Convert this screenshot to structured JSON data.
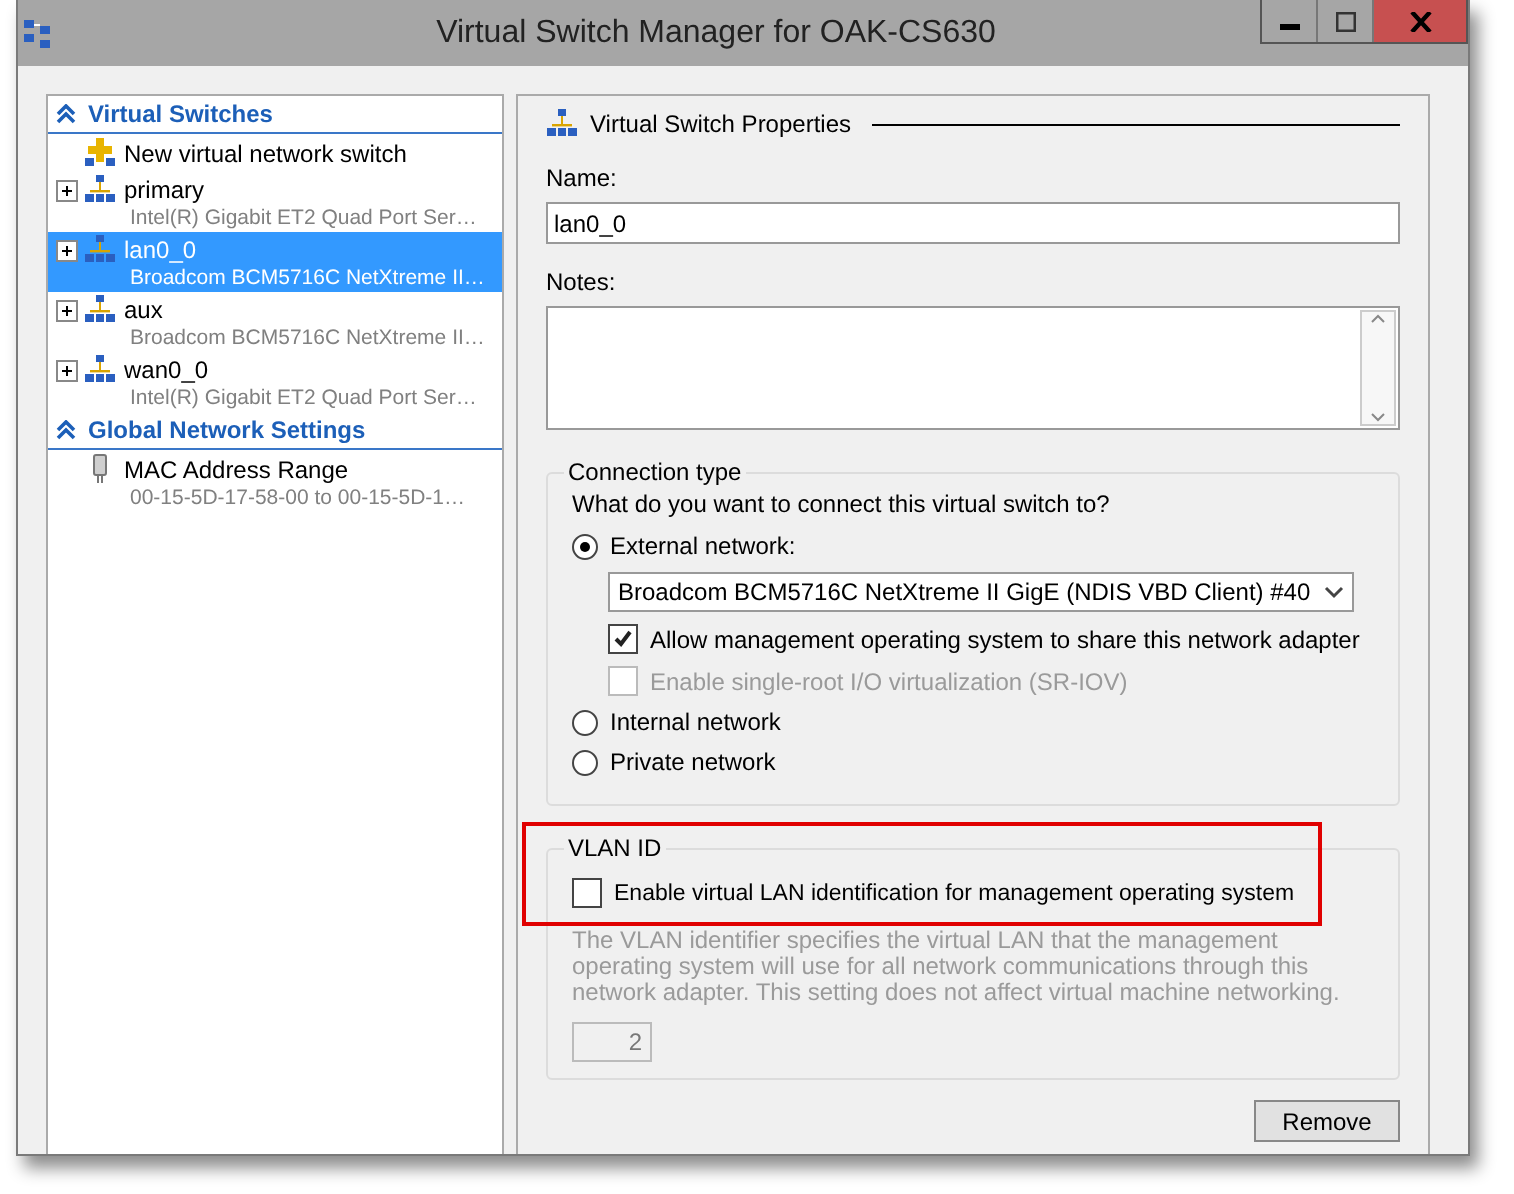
{
  "window": {
    "title": "Virtual Switch Manager for OAK-CS630"
  },
  "sidebar": {
    "sections": [
      {
        "title": "Virtual Switches",
        "items": [
          {
            "kind": "new",
            "name": "New virtual network switch",
            "selected": false
          },
          {
            "kind": "switch",
            "name": "primary",
            "detail": "Intel(R) Gigabit ET2 Quad Port Ser…",
            "selected": false,
            "expanded": false
          },
          {
            "kind": "switch",
            "name": "lan0_0",
            "detail": "Broadcom BCM5716C NetXtreme II…",
            "selected": true,
            "expanded": false
          },
          {
            "kind": "switch",
            "name": "aux",
            "detail": "Broadcom BCM5716C NetXtreme II…",
            "selected": false,
            "expanded": false
          },
          {
            "kind": "switch",
            "name": "wan0_0",
            "detail": "Intel(R) Gigabit ET2 Quad Port Ser…",
            "selected": false,
            "expanded": false
          }
        ]
      },
      {
        "title": "Global Network Settings",
        "items": [
          {
            "kind": "mac",
            "name": "MAC Address Range",
            "detail": "00-15-5D-17-58-00 to 00-15-5D-1…",
            "selected": false
          }
        ]
      }
    ]
  },
  "properties": {
    "heading": "Virtual Switch Properties",
    "name_label": "Name:",
    "name_value": "lan0_0",
    "notes_label": "Notes:",
    "connection": {
      "legend": "Connection type",
      "question": "What do you want to connect this virtual switch to?",
      "options": [
        {
          "label": "External network:",
          "selected": true
        },
        {
          "label": "Internal network",
          "selected": false
        },
        {
          "label": "Private network",
          "selected": false
        }
      ],
      "adapter": "Broadcom BCM5716C NetXtreme II GigE (NDIS VBD Client) #40",
      "checkboxes": [
        {
          "label": "Allow management operating system to share this network adapter",
          "checked": true,
          "disabled": false
        },
        {
          "label": "Enable single-root I/O virtualization (SR-IOV)",
          "checked": false,
          "disabled": true
        }
      ]
    },
    "vlan": {
      "legend": "VLAN ID",
      "checkbox": {
        "label": "Enable virtual LAN identification for management operating system",
        "checked": false
      },
      "description": "The VLAN identifier specifies the virtual LAN that the management operating system will use for all network communications through this network adapter. This setting does not affect virtual machine networking.",
      "value": "2",
      "disabled": true
    },
    "remove_button": "Remove"
  }
}
